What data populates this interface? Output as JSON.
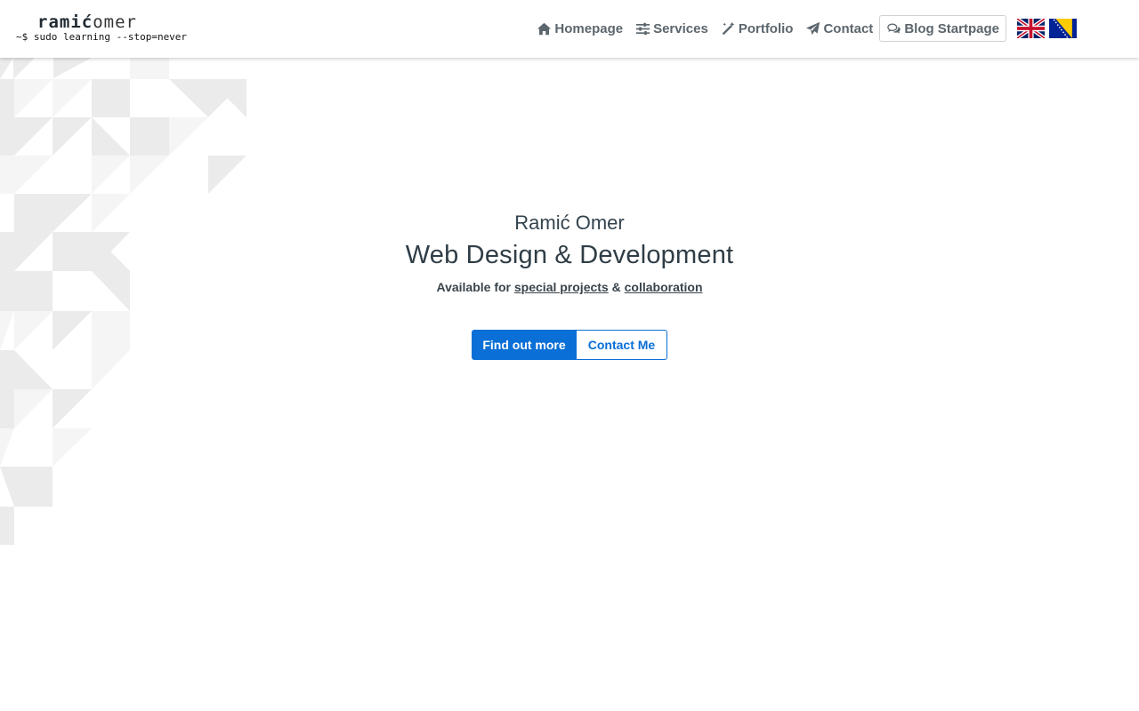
{
  "header": {
    "logo": {
      "top_bold": "ramić",
      "top_light": "omer",
      "tagline": "~$ sudo learning --stop=never"
    },
    "nav": [
      {
        "label": "Homepage",
        "icon": "home-icon"
      },
      {
        "label": "Services",
        "icon": "sliders-icon"
      },
      {
        "label": "Portfolio",
        "icon": "magic-wand-icon"
      },
      {
        "label": "Contact",
        "icon": "paper-plane-icon"
      },
      {
        "label": "Blog Startpage",
        "icon": "comments-icon"
      }
    ],
    "languages": [
      {
        "code": "en",
        "icon": "uk-flag-icon"
      },
      {
        "code": "bs",
        "icon": "bosnia-flag-icon"
      }
    ]
  },
  "hero": {
    "name": "Ramić Omer",
    "title": "Web Design & Development",
    "subtitle_prefix": "Available for ",
    "link_special": "special projects",
    "subtitle_and": " & ",
    "link_collab": "collaboration",
    "btn_primary": "Find out more",
    "btn_secondary": "Contact Me"
  },
  "colors": {
    "accent": "#0a6fd6",
    "nav_text": "#5c666d",
    "heading": "#2f3d46"
  }
}
